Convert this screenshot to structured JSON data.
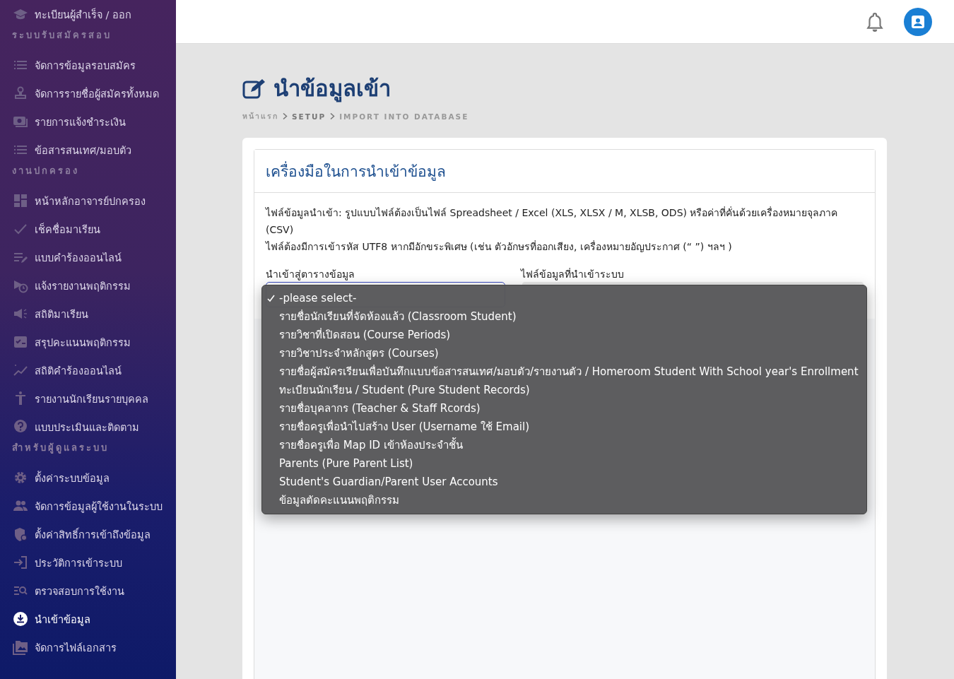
{
  "sidebar": [
    {
      "kind": "item",
      "label": "ทะเบียนผู้สำเร็จ / ออก",
      "selected": false
    },
    {
      "kind": "section",
      "label": "ระบบรับสมัครสอบ"
    },
    {
      "kind": "item",
      "label": "จัดการข้อมูลรอบสมัคร",
      "selected": false
    },
    {
      "kind": "item",
      "label": "จัดการรายชื่อผู้สมัครทั้งหมด",
      "selected": false
    },
    {
      "kind": "item",
      "label": "รายการแจ้งชำระเงิน",
      "selected": false
    },
    {
      "kind": "item",
      "label": "ข้อสารสนเทศ/มอบตัว",
      "selected": false
    },
    {
      "kind": "section",
      "label": "งานปกครอง"
    },
    {
      "kind": "item",
      "label": "หน้าหลักอาจารย์ปกครอง",
      "selected": false
    },
    {
      "kind": "item",
      "label": "เช็คชื่อมาเรียน",
      "selected": false
    },
    {
      "kind": "item",
      "label": "แบบคำร้องออนไลน์",
      "selected": false
    },
    {
      "kind": "item",
      "label": "แจ้งรายงานพฤติกรรม",
      "selected": false
    },
    {
      "kind": "item",
      "label": "สถิติมาเรียน",
      "selected": false
    },
    {
      "kind": "item",
      "label": "สรุปคะแนนพฤติกรรม",
      "selected": false
    },
    {
      "kind": "item",
      "label": "สถิติคำร้องออนไลน์",
      "selected": false
    },
    {
      "kind": "item",
      "label": "รายงานนักเรียนรายบุคคล",
      "selected": false
    },
    {
      "kind": "item",
      "label": "แบบประเมินและติดตาม",
      "selected": false
    },
    {
      "kind": "section",
      "label": "สำหรับผู้ดูแลระบบ"
    },
    {
      "kind": "item",
      "label": "ตั้งค่าระบบข้อมูล",
      "selected": false
    },
    {
      "kind": "item",
      "label": "จัดการข้อมูลผู้ใช้งานในระบบ",
      "selected": false
    },
    {
      "kind": "item",
      "label": "ตั้งค่าสิทธิ์การเข้าถึงข้อมูล",
      "selected": false
    },
    {
      "kind": "item",
      "label": "ประวัติการเข้าระบบ",
      "selected": false
    },
    {
      "kind": "item",
      "label": "ตรวจสอบการใช้งาน",
      "selected": false
    },
    {
      "kind": "item",
      "label": "นำเข้าข้อมูล",
      "selected": true
    },
    {
      "kind": "item",
      "label": "จัดการไฟล์เอกสาร",
      "selected": false
    }
  ],
  "page": {
    "title": "นำข้อมูลเข้า",
    "breadcrumb": [
      "หน้าแรก",
      "SETUP",
      "IMPORT INTO DATABASE"
    ]
  },
  "card": {
    "title": "เครื่องมือในการนำเข้าข้อมูล",
    "notes": [
      "ไฟล์ข้อมูลนำเข้า: รูปแบบไฟล์ต้องเป็นไฟล์ Spreadsheet / Excel (XLS, XLSX / M, XLSB, ODS) หรือค่าที่คั่นด้วยเครื่องหมายจุลภาค (CSV)",
      "ไฟล์ต้องมีการเข้ารหัส UTF8 หากมีอักขระพิเศษ (เช่น ตัวอักษรที่ออกเสียง, เครื่องหมายอัญประกาศ (“ ”) ฯลฯ )"
    ],
    "table_label": "นำเข้าสู่ตารางข้อมูล",
    "file_label": "ไฟล์ข้อมูลที่นำเข้าระบบ"
  },
  "dropdown": {
    "options": [
      {
        "label": "-please select-",
        "selected": true
      },
      {
        "label": "รายชื่อนักเรียนที่จัดห้องแล้ว (Classroom Student)",
        "selected": false
      },
      {
        "label": "รายวิชาที่เปิดสอน (Course Periods)",
        "selected": false
      },
      {
        "label": "รายวิชาประจำหลักสูตร (Courses)",
        "selected": false
      },
      {
        "label": "รายชื่อผู้สมัครเรียนเพื่อบันทึกแบบข้อสารสนเทศ/มอบตัว/รายงานตัว / Homeroom Student With School year's Enrollment",
        "selected": false
      },
      {
        "label": "ทะเบียนนักเรียน / Student (Pure Student Records)",
        "selected": false
      },
      {
        "label": "รายชื่อบุคลากร (Teacher & Staff Rcords)",
        "selected": false
      },
      {
        "label": "รายชื่อครูเพื่อนำไปสร้าง User (Username ใช้ Email)",
        "selected": false
      },
      {
        "label": "รายชื่อครูเพื่อ Map ID เข้าห้องประจำชั้น",
        "selected": false
      },
      {
        "label": "Parents (Pure Parent List)",
        "selected": false
      },
      {
        "label": "Student's Guardian/Parent User Accounts",
        "selected": false
      },
      {
        "label": "ข้อมูลตัดคะแนนพฤติกรรม",
        "selected": false
      }
    ]
  }
}
